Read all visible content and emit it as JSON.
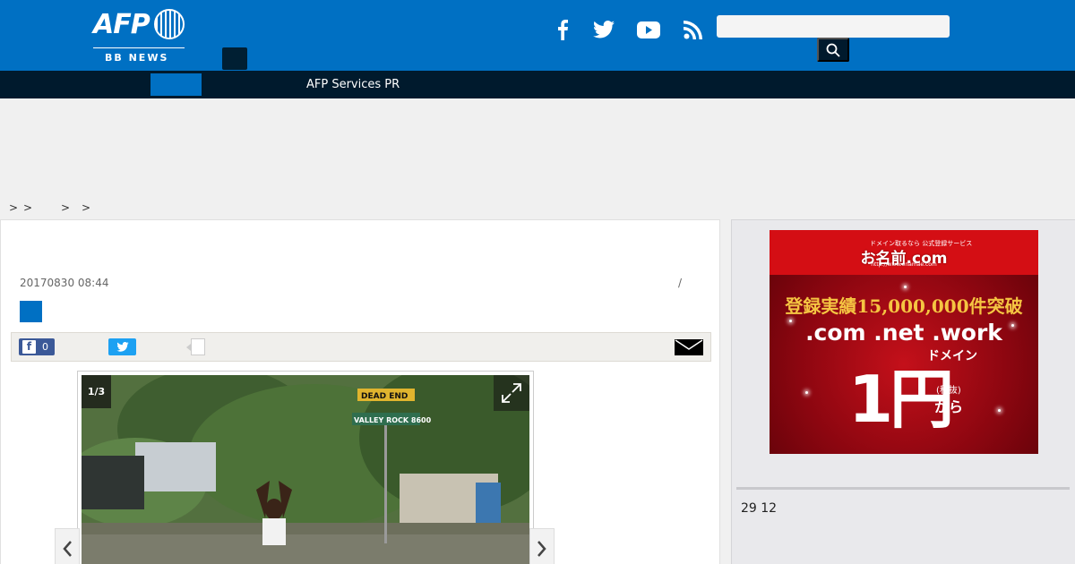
{
  "header": {
    "logo_text": "AFP",
    "logo_subtext": "BB NEWS",
    "search_placeholder": "",
    "brand_color": "#0070c3",
    "nav_color": "#001a2d",
    "social_icons": [
      "facebook-icon",
      "twitter-icon",
      "youtube-icon",
      "rss-icon"
    ]
  },
  "nav": {
    "items": [
      {
        "label": "AFP Services PR"
      }
    ]
  },
  "breadcrumb": {
    "separators": [
      ">",
      ">",
      ">",
      ">"
    ]
  },
  "article": {
    "date": "20170830 08:44",
    "slash": "/",
    "share": {
      "facebook_count": "0"
    },
    "gallery": {
      "counter": "1/3",
      "photo_sign_1": "DEAD END",
      "photo_sign_2": "VALLEY ROCK 8600"
    }
  },
  "sidebar": {
    "ad": {
      "tagline": "ドメイン取るなら 公式登録サービス",
      "brand": "お名前.com",
      "url": "http://www.onamae.com",
      "award": "登録実績15,000,000件突破",
      "domains": ".com .net .work",
      "domain_label": "ドメイン",
      "price": "1円",
      "tax": "(税抜)",
      "suffix": "から"
    },
    "text": "29 12"
  }
}
